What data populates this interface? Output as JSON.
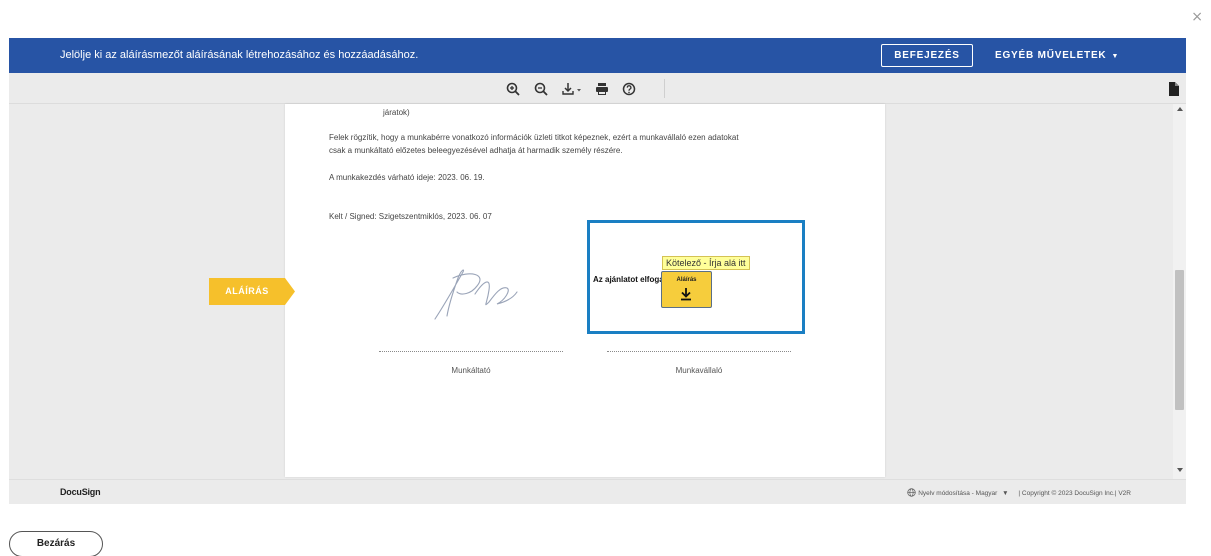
{
  "window": {
    "close_glyph": "×"
  },
  "topbar": {
    "message": "Jelölje ki az aláírásmezőt aláírásának létrehozásához és hozzáadásához.",
    "finish_label": "BEFEJEZÉS",
    "other_actions_label": "EGYÉB MŰVELETEK",
    "other_actions_caret": "▼",
    "color": "#2754a5"
  },
  "toolbar": {
    "icons": [
      "zoom-in-icon",
      "zoom-out-icon",
      "download-icon",
      "print-icon",
      "help-icon",
      "document-icon"
    ]
  },
  "document": {
    "line_routes": "járatok)",
    "para1_line1": "Felek rögzítik, hogy a munkabérre vonatkozó információk üzleti titkot képeznek, ezért a munkavállaló ezen adatokat",
    "para1_line2": "csak a munkáltató előzetes beleegyezésével adhatja át harmadik személy részére.",
    "start_date": "A munkakezdés várható ideje:  2023. 06. 19.",
    "signed_place_date": "Kelt / Signed:  Szigetszentmiklós, 2023. 06. 07",
    "employer_caption": "Munkáltató",
    "employee_caption": "Munkavállaló"
  },
  "sign_field": {
    "offer_label": "Az ajánlatot elfogadom:",
    "tooltip": "Kötelező - Írja alá itt",
    "field_label": "Aláírás",
    "flag_label": "ALÁÍRÁS",
    "field_color": "#f6cd3c",
    "box_border_color": "#1a7fc3"
  },
  "footer": {
    "logo": "DocuSign",
    "language": "Nyelv módosítása - Magyar",
    "language_caret": "▼",
    "copyright": "|  Copyright © 2023 DocuSign Inc.| V2R"
  },
  "bottom": {
    "close_label": "Bezárás"
  }
}
